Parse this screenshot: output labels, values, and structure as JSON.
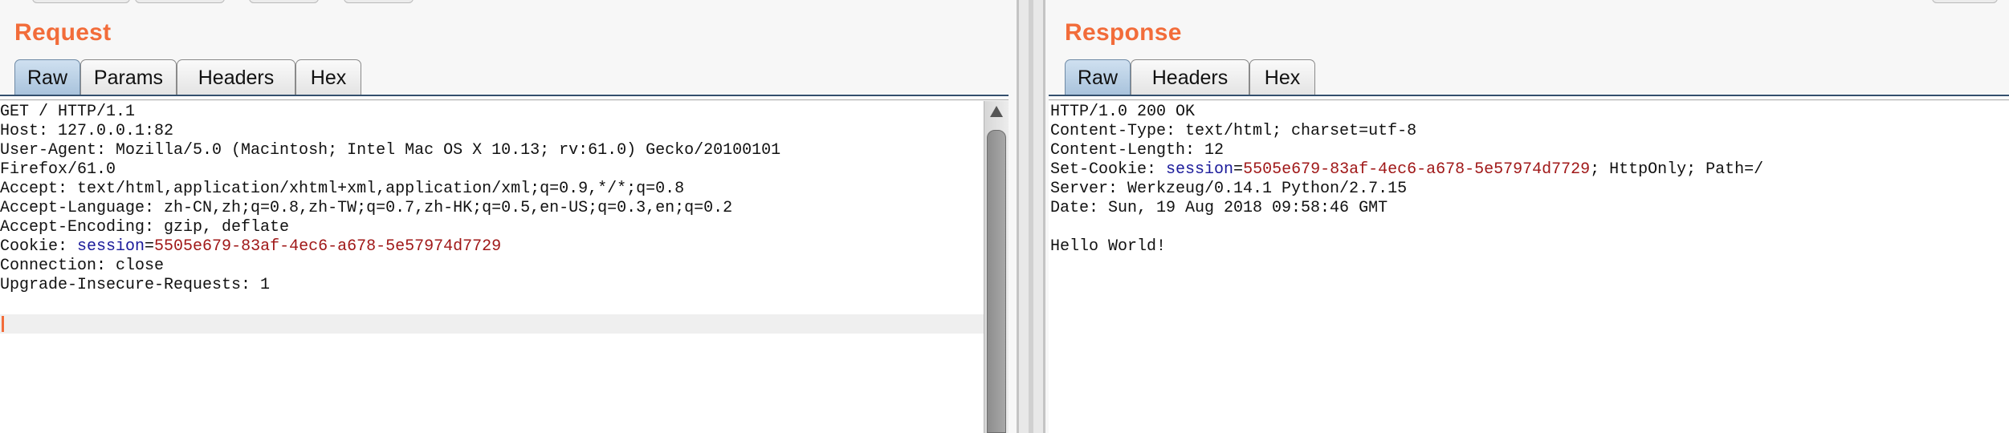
{
  "request": {
    "title": "Request",
    "tabs": [
      "Raw",
      "Params",
      "Headers",
      "Hex"
    ],
    "active_tab": "Raw",
    "lines": [
      [
        {
          "t": "GET / HTTP/1.1"
        }
      ],
      [
        {
          "t": "Host: 127.0.0.1:82"
        }
      ],
      [
        {
          "t": "User-Agent: Mozilla/5.0 (Macintosh; Intel Mac OS X 10.13; rv:61.0) Gecko/20100101"
        }
      ],
      [
        {
          "t": "Firefox/61.0"
        }
      ],
      [
        {
          "t": "Accept: text/html,application/xhtml+xml,application/xml;q=0.9,*/*;q=0.8"
        }
      ],
      [
        {
          "t": "Accept-Language: zh-CN,zh;q=0.8,zh-TW;q=0.7,zh-HK;q=0.5,en-US;q=0.3,en;q=0.2"
        }
      ],
      [
        {
          "t": "Accept-Encoding: gzip, deflate"
        }
      ],
      [
        {
          "t": "Cookie: "
        },
        {
          "t": "session",
          "c": "k"
        },
        {
          "t": "="
        },
        {
          "t": "5505e679-83af-4ec6-a678-5e57974d7729",
          "c": "v"
        }
      ],
      [
        {
          "t": "Connection: close"
        }
      ],
      [
        {
          "t": "Upgrade-Insecure-Requests: 1"
        }
      ],
      [
        {
          "t": ""
        }
      ],
      [
        {
          "t": ""
        }
      ]
    ]
  },
  "response": {
    "title": "Response",
    "tabs": [
      "Raw",
      "Headers",
      "Hex"
    ],
    "active_tab": "Raw",
    "lines": [
      [
        {
          "t": "HTTP/1.0 200 OK"
        }
      ],
      [
        {
          "t": "Content-Type: text/html; charset=utf-8"
        }
      ],
      [
        {
          "t": "Content-Length: 12"
        }
      ],
      [
        {
          "t": "Set-Cookie: "
        },
        {
          "t": "session",
          "c": "k"
        },
        {
          "t": "="
        },
        {
          "t": "5505e679-83af-4ec6-a678-5e57974d7729",
          "c": "v"
        },
        {
          "t": "; HttpOnly; Path=/"
        }
      ],
      [
        {
          "t": "Server: Werkzeug/0.14.1 Python/2.7.15"
        }
      ],
      [
        {
          "t": "Date: Sun, 19 Aug 2018 09:58:46 GMT"
        }
      ],
      [
        {
          "t": ""
        }
      ],
      [
        {
          "t": "Hello World!"
        }
      ]
    ]
  },
  "colors": {
    "accent": "#f26c3a",
    "cookie_name": "#1a1a9a",
    "cookie_value": "#a01818",
    "active_tab": "#a9c3dc"
  },
  "icons": [
    "scroll-up-arrow-icon"
  ]
}
